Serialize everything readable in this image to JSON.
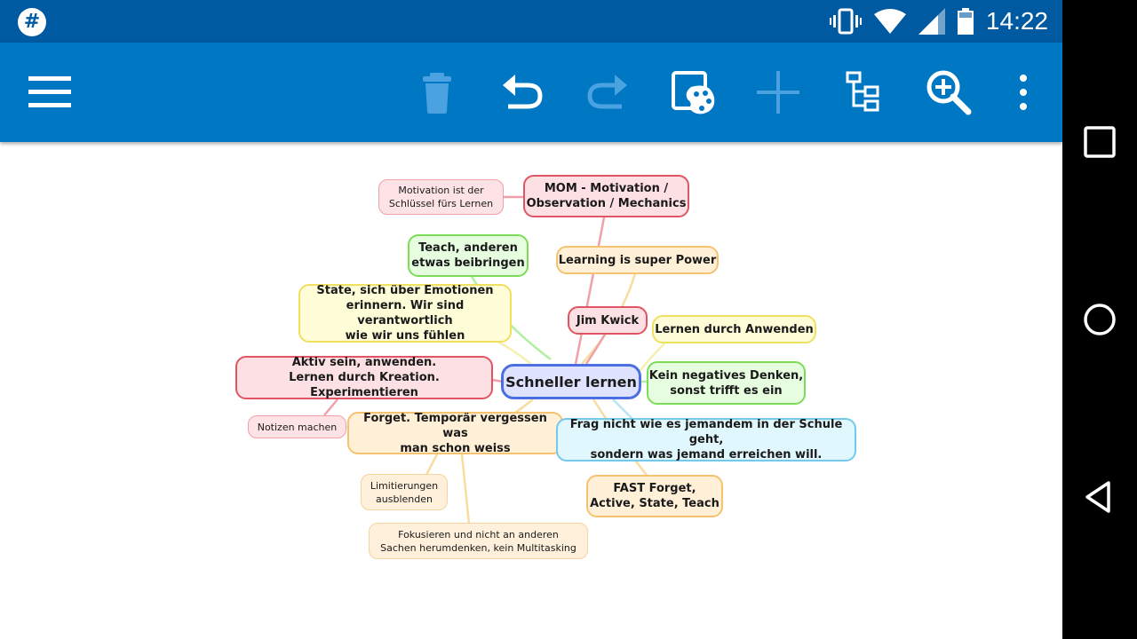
{
  "status_bar": {
    "app_icon": "hash-badge-icon",
    "app_icon_glyph": "#",
    "time": "14:22",
    "icons": [
      "vibrate-icon",
      "wifi-icon",
      "signal-icon",
      "battery-icon"
    ]
  },
  "toolbar": {
    "icons": [
      "menu-icon",
      "trash-icon",
      "undo-icon",
      "redo-icon",
      "palette-icon",
      "add-icon",
      "tree-view-icon",
      "zoom-icon",
      "more-vert-icon"
    ],
    "enabled": {
      "menu": true,
      "trash": false,
      "undo": true,
      "redo": false,
      "palette": true,
      "add": false,
      "tree": true,
      "zoom": true,
      "more": true
    }
  },
  "nav_bar": {
    "icons": [
      "recents-square-icon",
      "home-circle-icon",
      "back-triangle-icon"
    ]
  },
  "colors": {
    "status_bar": "#005aa1",
    "toolbar": "#0077c2",
    "nav_bar": "#000000",
    "red": "#e05563",
    "green": "#7cdc58",
    "yellow": "#f0e060",
    "orange": "#f5c36f",
    "blue": "#74c8ea",
    "root": "#4d6ee0"
  },
  "mindmap": {
    "root": "Schneller lernen",
    "nodes": {
      "mom": "MOM - Motivation /\nObservation / Mechanics",
      "motivation": "Motivation ist der\nSchlüssel fürs Lernen",
      "teach": "Teach, anderen\netwas beibringen",
      "learning_power": "Learning is super Power",
      "state": "State, sich über Emotionen\nerinnern. Wir sind verantwortlich\nwie wir uns fühlen",
      "jim": "Jim Kwick",
      "anwenden": "Lernen durch Anwenden",
      "aktiv": "Aktiv sein, anwenden.\nLernen durch Kreation. Experimentieren",
      "negativ": "Kein negatives Denken,\nsonst trifft es ein",
      "notizen": "Notizen machen",
      "forget": "Forget. Temporär vergessen was\nman schon weiss",
      "frag": "Frag nicht wie es jemandem in der Schule geht,\nsondern was jemand erreichen will.",
      "limitierungen": "Limitierungen\nausblenden",
      "fast": "FAST Forget,\nActive, State, Teach",
      "fokussieren": "Fokusieren und nicht an anderen\nSachen herumdenken, kein Multitasking"
    }
  }
}
